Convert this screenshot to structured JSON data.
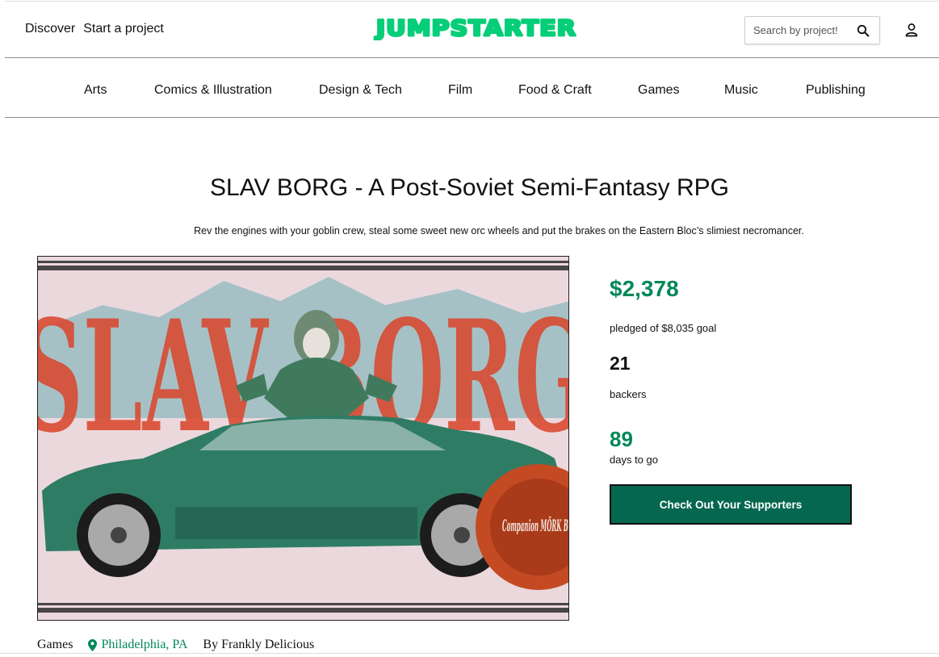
{
  "header": {
    "discover_label": "Discover",
    "start_label": "Start a project",
    "logo_text": "JUMPSTARTER",
    "search_placeholder": "Search by project!",
    "brand_color": "#05ce78"
  },
  "categories": [
    "Arts",
    "Comics & Illustration",
    "Design & Tech",
    "Film",
    "Food & Craft",
    "Games",
    "Music",
    "Publishing"
  ],
  "project": {
    "title": "SLAV BORG - A Post-Soviet Semi-Fantasy RPG",
    "blurb": "Rev the engines with your goblin crew, steal some sweet new orc wheels and put the brakes on the Eastern Bloc’s slimiest necromancer.",
    "image_text": "SLAV BORG",
    "seal_text": "Companion MÖRK BORG",
    "pledged": "$2,378",
    "goal_text": "pledged of $8,035 goal",
    "backers_count": "21",
    "backers_label": "backers",
    "days_count": "89",
    "days_label": "days to go",
    "cta_label": "Check Out Your Supporters",
    "category": "Games",
    "location": "Philadelphia, PA",
    "creator": "By Frankly Delicious"
  },
  "colors": {
    "accent": "#028858",
    "button": "#05674f"
  }
}
